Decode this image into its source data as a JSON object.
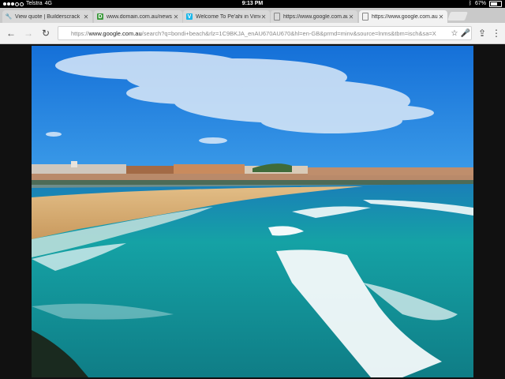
{
  "status_bar": {
    "carrier": "Telstra",
    "network": "4G",
    "time": "9:13 PM",
    "battery_percent": "67%",
    "battery_level": 0.67
  },
  "tabs": [
    {
      "label": "View quote | Builderscrack",
      "icon": "wrench-icon",
      "active": false
    },
    {
      "label": "www.domain.com.au/news",
      "icon": "domain-favicon-icon",
      "active": false
    },
    {
      "label": "Welcome To Pe'ahi in Vimeo",
      "icon": "vimeo-icon",
      "active": false
    },
    {
      "label": "https://www.google.com.au",
      "icon": "page-icon",
      "active": false
    },
    {
      "label": "https://www.google.com.au",
      "icon": "page-icon",
      "active": true
    }
  ],
  "address_bar": {
    "scheme": "https://",
    "host": "www.google.com.au",
    "rest": "/search?q=bondi+beach&rlz=1C9BKJA_enAU670AU670&hl=en-GB&prmd=minv&source=lnms&tbm=isch&sa=X"
  },
  "colors": {
    "sky": "#1f7fdc",
    "ocean": "#1aa6a4",
    "sand": "#d9b27a",
    "active_tab": "#f2f2f2"
  }
}
